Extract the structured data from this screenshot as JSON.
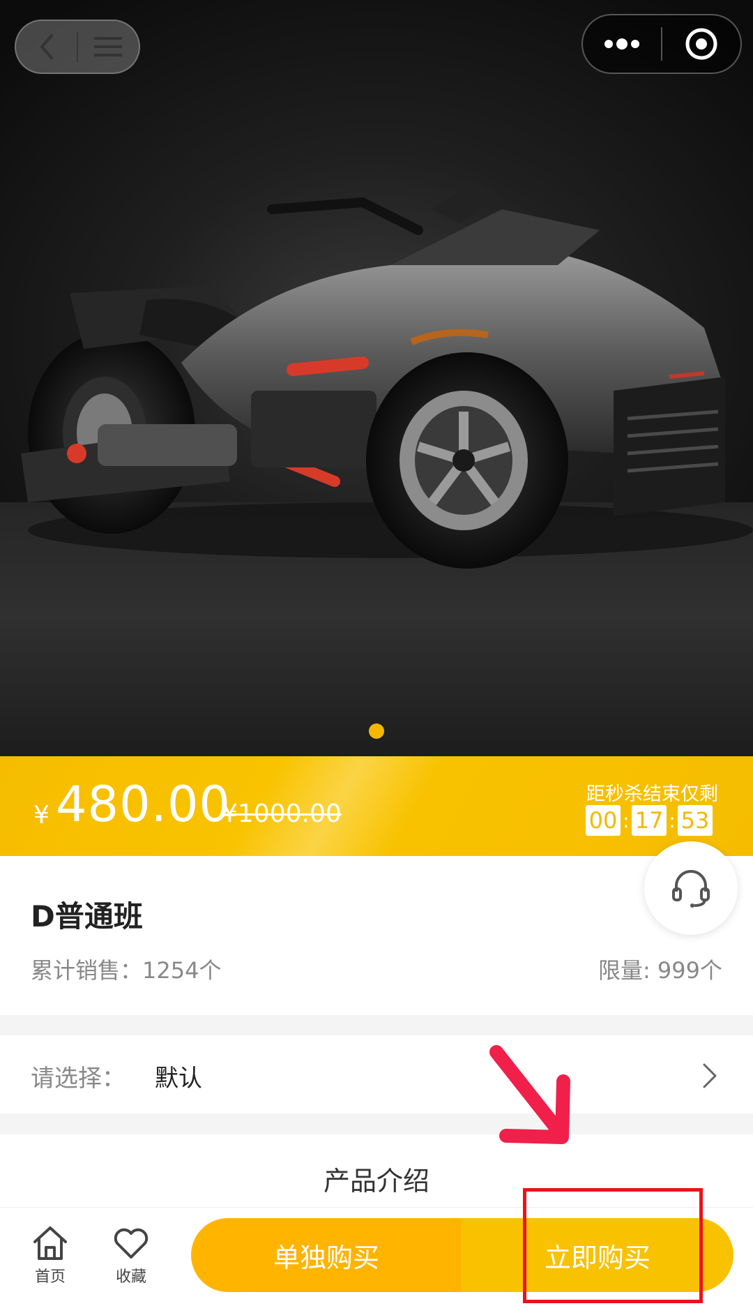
{
  "hero": {
    "slide_count": 1,
    "active_slide": 1,
    "image_alt_icon": "motorcycle-image"
  },
  "capsule": {
    "back_icon": "chevron-left-icon",
    "home_icon": "menu-icon",
    "more_icon": "more-dots-icon",
    "close_icon": "target-icon"
  },
  "price": {
    "currency": "¥",
    "current": "480.00",
    "original": "¥1000.00",
    "countdown_label": "距秒杀结束仅剩",
    "hours": "00",
    "minutes": "17",
    "seconds": "53",
    "colon": ":"
  },
  "product": {
    "title": "D普通班",
    "sales": "累计销售：1254个",
    "limit": "限量: 999个"
  },
  "select": {
    "label": "请选择：",
    "value": "默认"
  },
  "intro": {
    "title": "产品介绍"
  },
  "bottom_bar": {
    "home_label": "首页",
    "fav_label": "收藏",
    "single_buy_label": "单独购买",
    "buy_now_label": "立即购买"
  },
  "colors": {
    "accent": "#f5b800",
    "accent_dark": "#ffb400",
    "annotation": "#e8141c"
  }
}
